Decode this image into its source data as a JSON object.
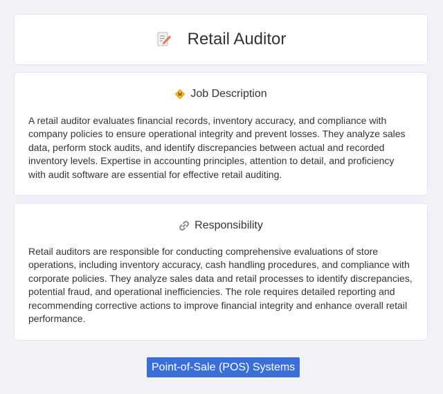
{
  "header": {
    "title": "Retail Auditor",
    "icon": "memo-pencil-icon"
  },
  "sections": [
    {
      "heading": "Job Description",
      "icon": "diamond-badge-icon",
      "text": "A retail auditor evaluates financial records, inventory accuracy, and compliance with company policies to ensure operational integrity and prevent losses. They analyze sales data, perform stock audits, and identify discrepancies between actual and recorded inventory levels. Expertise in accounting principles, attention to detail, and proficiency with audit software are essential for effective retail auditing."
    },
    {
      "heading": "Responsibility",
      "icon": "link-icon",
      "text": "Retail auditors are responsible for conducting comprehensive evaluations of store operations, including inventory accuracy, cash handling procedures, and compliance with corporate policies. They analyze sales data and retail processes to identify discrepancies, potential fraud, and operational inefficiencies. The role requires detailed reporting and recommending corrective actions to improve financial integrity and enhance overall retail performance."
    }
  ],
  "skill_tag": {
    "label": "Point-of-Sale (POS) Systems"
  },
  "colors": {
    "background": "#f0f2f8",
    "card": "#ffffff",
    "accent": "#3a6fd8",
    "text": "#333333"
  }
}
